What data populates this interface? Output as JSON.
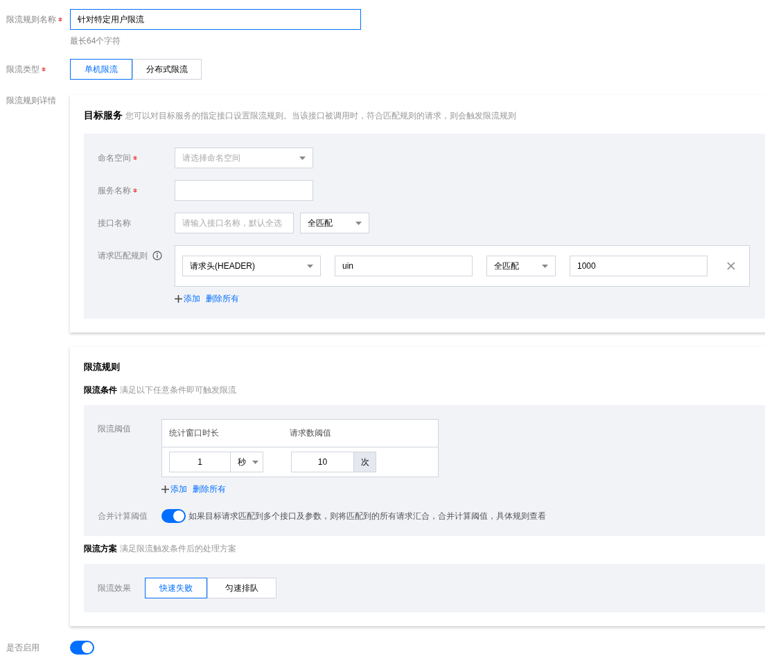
{
  "rule_name": {
    "label": "限流规则名称",
    "required": true,
    "value": "针对特定用户限流",
    "hint": "最长64个字符"
  },
  "rule_type": {
    "label": "限流类型",
    "required": true,
    "options": [
      {
        "label": "单机限流",
        "selected": true
      },
      {
        "label": "分布式限流",
        "selected": false
      }
    ]
  },
  "details": {
    "label": "限流规则详情",
    "target_service": {
      "title": "目标服务",
      "description": "您可以对目标服务的指定接口设置限流规则。当该接口被调用时，符合匹配规则的请求，则会触发限流规则",
      "fields": [
        {
          "kind": "select",
          "label": "命名空间",
          "required": true,
          "placeholder": "请选择命名空间"
        },
        {
          "kind": "input",
          "label": "服务名称",
          "required": true
        },
        {
          "kind": "input_select",
          "label": "接口名称",
          "required": false,
          "placeholder": "请输入接口名称，默认全选",
          "select_value": "全匹配"
        },
        {
          "kind": "match_rules",
          "label": "请求匹配规则",
          "required": false,
          "info": true,
          "rows": [
            {
              "source": "请求头(HEADER)",
              "key": "uin",
              "operator": "全匹配",
              "value": "1000"
            }
          ],
          "add": "添加",
          "delete_all": "删除所有"
        }
      ]
    },
    "rate_rule": {
      "title": "限流规则",
      "conditions": {
        "title": "限流条件",
        "description": "满足以下任意条件即可触发限流",
        "threshold": {
          "label": "限流阈值",
          "columns": [
            "统计窗口时长",
            "请求数阈值"
          ],
          "rows": [
            {
              "duration": "1",
              "unit": "秒",
              "count": "10",
              "count_unit": "次"
            }
          ],
          "add": "添加",
          "delete_all": "删除所有"
        },
        "merge": {
          "label": "合并计算阈值",
          "on": true,
          "description": "如果目标请求匹配到多个接口及参数，则将匹配到的所有请求汇合，合并计算阈值，具体规则查看"
        }
      },
      "scheme": {
        "title": "限流方案",
        "description": "满足限流触发条件后的处理方案",
        "effect": {
          "label": "限流效果",
          "options": [
            {
              "label": "快速失败",
              "selected": true
            },
            {
              "label": "匀速排队",
              "selected": false
            }
          ]
        }
      }
    }
  },
  "enable": {
    "label": "是否启用",
    "on": true
  }
}
